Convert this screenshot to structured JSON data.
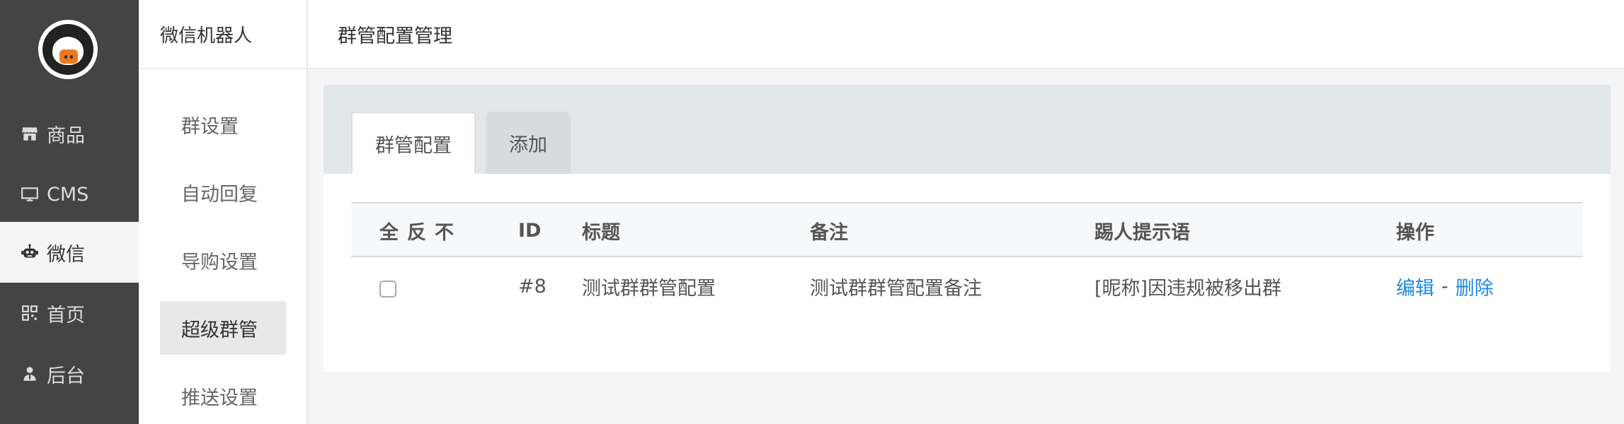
{
  "leftnav": {
    "items": [
      {
        "label": "商品",
        "icon": "store-icon"
      },
      {
        "label": "CMS",
        "icon": "monitor-icon"
      },
      {
        "label": "微信",
        "icon": "robot-icon"
      },
      {
        "label": "首页",
        "icon": "grid-icon"
      },
      {
        "label": "后台",
        "icon": "user-icon"
      }
    ],
    "active_index": 2
  },
  "subnav": {
    "title": "微信机器人",
    "items": [
      "群设置",
      "自动回复",
      "导购设置",
      "超级群管",
      "推送设置"
    ],
    "active_index": 3
  },
  "header": {
    "title": "群管配置管理"
  },
  "tabs": [
    {
      "label": "群管配置",
      "active": true
    },
    {
      "label": "添加",
      "active": false
    }
  ],
  "table": {
    "select": {
      "all": "全",
      "invert": "反",
      "none": "不"
    },
    "columns": [
      "ID",
      "标题",
      "备注",
      "踢人提示语",
      "操作"
    ],
    "rows": [
      {
        "id": "#8",
        "title": "测试群群管配置",
        "note": "测试群群管配置备注",
        "kick_msg": "[昵称]因违规被移出群",
        "edit": "编辑",
        "separator": "-",
        "delete": "删除"
      }
    ]
  },
  "colors": {
    "leftnav_bg": "#444444",
    "link": "#1e88e5",
    "tabbar_bg": "#e2e7ea",
    "logo_accent": "#f07820"
  }
}
